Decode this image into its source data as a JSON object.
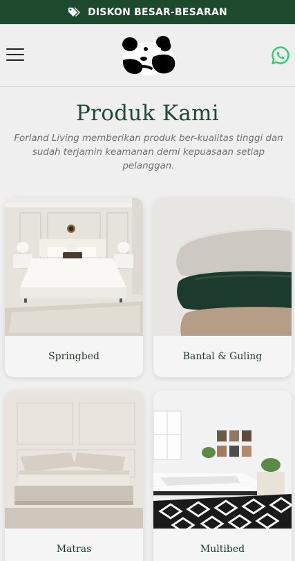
{
  "promo": {
    "text": "DISKON BESAR-BESARAN",
    "icon": "tags-icon"
  },
  "header": {
    "menu_icon": "hamburger-menu-icon",
    "logo": "panda-logo",
    "whatsapp_icon": "whatsapp-icon",
    "whatsapp_color": "#25d366"
  },
  "section": {
    "title": "Produk Kami",
    "description": "Forland Living memberikan produk ber-kualitas tinggi dan sudah terjamin keamanan demi kepuasaan setiap pelanggan."
  },
  "products": [
    {
      "label": "Springbed"
    },
    {
      "label": "Bantal & Guling"
    },
    {
      "label": "Matras"
    },
    {
      "label": "Multibed"
    }
  ],
  "colors": {
    "brand_green": "#1d4a2c",
    "background": "#efefef"
  }
}
